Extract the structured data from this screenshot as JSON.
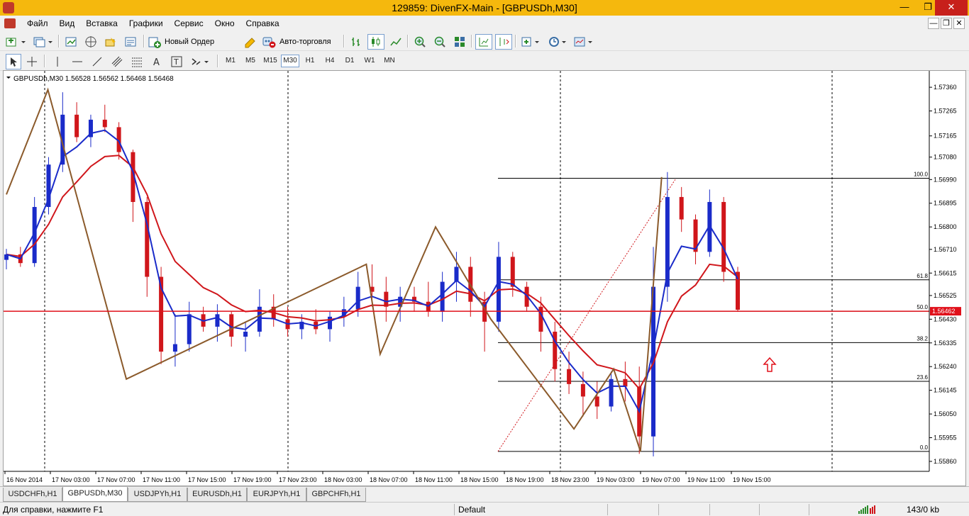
{
  "window": {
    "title": "129859: DivenFX-Main - [GBPUSDh,M30]"
  },
  "menu": {
    "items": [
      "Файл",
      "Вид",
      "Вставка",
      "Графики",
      "Сервис",
      "Окно",
      "Справка"
    ]
  },
  "toolbar": {
    "new_order_label": "Новый Ордер",
    "auto_trading_label": "Авто-торговля"
  },
  "timeframes": [
    "M1",
    "M5",
    "M15",
    "M30",
    "H1",
    "H4",
    "D1",
    "W1",
    "MN"
  ],
  "active_timeframe": "M30",
  "chart": {
    "header": "GBPUSDh,M30  1.56528 1.56562 1.56468 1.56468",
    "current_price_label": "1.56462",
    "colors": {
      "bull": "#1a2bc9",
      "bear": "#d0161b",
      "zigzag": "#8b5a2b",
      "ma_fast": "#1a2bc9",
      "ma_slow": "#d0161b",
      "price_line": "#e0101a",
      "arrow": "#e0101a"
    }
  },
  "chart_data": {
    "type": "candlestick",
    "symbol": "GBPUSDh",
    "timeframe": "M30",
    "y_ticks": [
      "1.57360",
      "1.57265",
      "1.57165",
      "1.57080",
      "1.56990",
      "1.56895",
      "1.56800",
      "1.56710",
      "1.56615",
      "1.56525",
      "1.56430",
      "1.56335",
      "1.56240",
      "1.56145",
      "1.56050",
      "1.55955",
      "1.55860"
    ],
    "x_ticks": [
      "16 Nov 2014",
      "17 Nov 03:00",
      "17 Nov 07:00",
      "17 Nov 11:00",
      "17 Nov 15:00",
      "17 Nov 19:00",
      "17 Nov 23:00",
      "18 Nov 03:00",
      "18 Nov 07:00",
      "18 Nov 11:00",
      "18 Nov 15:00",
      "18 Nov 19:00",
      "18 Nov 23:00",
      "19 Nov 03:00",
      "19 Nov 07:00",
      "19 Nov 11:00",
      "19 Nov 15:00"
    ],
    "ylim": [
      1.5582,
      1.5742
    ],
    "price_line": 1.56462,
    "fibonacci": [
      {
        "level": "100.0",
        "price": 1.56995
      },
      {
        "level": "61.8",
        "price": 1.56588
      },
      {
        "level": "50.0",
        "price": 1.56462
      },
      {
        "level": "38.2",
        "price": 1.56336
      },
      {
        "level": "23.6",
        "price": 1.56181
      },
      {
        "level": "0.0",
        "price": 1.559
      }
    ],
    "candles": [
      [
        1.56668,
        1.56712,
        1.5663,
        1.5669
      ],
      [
        1.5669,
        1.5672,
        1.5664,
        1.56655
      ],
      [
        1.56655,
        1.5692,
        1.5664,
        1.5688
      ],
      [
        1.5688,
        1.5708,
        1.5685,
        1.5705
      ],
      [
        1.5705,
        1.5734,
        1.5702,
        1.5725
      ],
      [
        1.5725,
        1.573,
        1.5714,
        1.5716
      ],
      [
        1.5716,
        1.5725,
        1.5712,
        1.5723
      ],
      [
        1.5723,
        1.5729,
        1.5718,
        1.572
      ],
      [
        1.572,
        1.5722,
        1.5707,
        1.571
      ],
      [
        1.571,
        1.5711,
        1.5682,
        1.569
      ],
      [
        1.569,
        1.5692,
        1.5652,
        1.566
      ],
      [
        1.566,
        1.5664,
        1.5625,
        1.563
      ],
      [
        1.563,
        1.5645,
        1.5624,
        1.5633
      ],
      [
        1.5633,
        1.565,
        1.563,
        1.5645
      ],
      [
        1.5645,
        1.5648,
        1.5638,
        1.564
      ],
      [
        1.564,
        1.5649,
        1.5634,
        1.5645
      ],
      [
        1.5645,
        1.5646,
        1.5632,
        1.5636
      ],
      [
        1.5636,
        1.5642,
        1.563,
        1.5638
      ],
      [
        1.5638,
        1.5655,
        1.5636,
        1.5648
      ],
      [
        1.5648,
        1.5653,
        1.564,
        1.5643
      ],
      [
        1.5643,
        1.5648,
        1.5636,
        1.5639
      ],
      [
        1.5639,
        1.5645,
        1.5635,
        1.5642
      ],
      [
        1.5642,
        1.5647,
        1.5637,
        1.5639
      ],
      [
        1.5639,
        1.5646,
        1.5634,
        1.5644
      ],
      [
        1.5644,
        1.5652,
        1.564,
        1.5647
      ],
      [
        1.5647,
        1.5662,
        1.5644,
        1.5656
      ],
      [
        1.5656,
        1.5665,
        1.5648,
        1.5654
      ],
      [
        1.5654,
        1.566,
        1.5642,
        1.5648
      ],
      [
        1.5648,
        1.5656,
        1.5642,
        1.5652
      ],
      [
        1.5652,
        1.5656,
        1.5646,
        1.565
      ],
      [
        1.565,
        1.5658,
        1.5644,
        1.5646
      ],
      [
        1.5646,
        1.5662,
        1.5642,
        1.5658
      ],
      [
        1.5658,
        1.567,
        1.565,
        1.5664
      ],
      [
        1.5664,
        1.5668,
        1.5644,
        1.565
      ],
      [
        1.565,
        1.5654,
        1.563,
        1.5642
      ],
      [
        1.5642,
        1.5674,
        1.5638,
        1.5668
      ],
      [
        1.5668,
        1.567,
        1.5652,
        1.5656
      ],
      [
        1.5656,
        1.5658,
        1.5646,
        1.5648
      ],
      [
        1.5648,
        1.5652,
        1.563,
        1.5638
      ],
      [
        1.5638,
        1.5642,
        1.5618,
        1.5623
      ],
      [
        1.5623,
        1.563,
        1.5613,
        1.5617
      ],
      [
        1.5617,
        1.5622,
        1.5604,
        1.5612
      ],
      [
        1.5612,
        1.5618,
        1.5603,
        1.5608
      ],
      [
        1.5608,
        1.5622,
        1.5606,
        1.5619
      ],
      [
        1.5619,
        1.5626,
        1.561,
        1.5616
      ],
      [
        1.5616,
        1.5624,
        1.5589,
        1.5596
      ],
      [
        1.5596,
        1.5672,
        1.5588,
        1.5656
      ],
      [
        1.5656,
        1.5702,
        1.565,
        1.5692
      ],
      [
        1.5692,
        1.5696,
        1.5678,
        1.5683
      ],
      [
        1.5683,
        1.5685,
        1.5665,
        1.567
      ],
      [
        1.567,
        1.5695,
        1.5668,
        1.569
      ],
      [
        1.569,
        1.5692,
        1.5658,
        1.5662
      ],
      [
        1.5662,
        1.5664,
        1.5646,
        1.56468
      ]
    ],
    "zigzag": [
      [
        1.5693,
        0
      ],
      [
        1.5735,
        0.045
      ],
      [
        1.5619,
        0.13
      ],
      [
        1.5665,
        0.39
      ],
      [
        1.5629,
        0.405
      ],
      [
        1.568,
        0.465
      ],
      [
        1.5643,
        0.525
      ],
      [
        1.5599,
        0.615
      ],
      [
        1.5623,
        0.658
      ],
      [
        1.559,
        0.687
      ],
      [
        1.57,
        0.71
      ]
    ]
  },
  "tabs": [
    "USDCHFh,H1",
    "GBPUSDh,M30",
    "USDJPYh,H1",
    "EURUSDh,H1",
    "EURJPYh,H1",
    "GBPCHFh,H1"
  ],
  "active_tab": "GBPUSDh,M30",
  "statusbar": {
    "help": "Для справки, нажмите F1",
    "profile": "Default",
    "traffic": "143/0 kb"
  }
}
